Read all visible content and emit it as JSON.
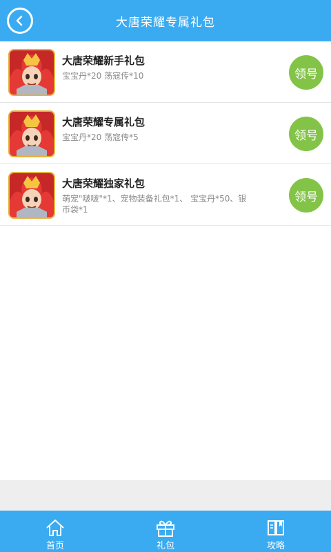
{
  "header": {
    "title": "大唐荣耀专属礼包",
    "back_icon": "chevron-left-icon"
  },
  "gifts": [
    {
      "title": "大唐荣耀新手礼包",
      "desc": "宝宝丹*20 荡寇传*10",
      "button": "领号"
    },
    {
      "title": "大唐荣耀专属礼包",
      "desc": "宝宝丹*20 荡寇传*5",
      "button": "领号"
    },
    {
      "title": "大唐荣耀独家礼包",
      "desc": "萌宠\"啵啵\"*1、宠物装备礼包*1、 宝宝丹*50、银币袋*1",
      "button": "领号"
    }
  ],
  "tabbar": {
    "items": [
      {
        "label": "首页",
        "icon": "home-icon"
      },
      {
        "label": "礼包",
        "icon": "gift-icon"
      },
      {
        "label": "攻略",
        "icon": "book-icon"
      }
    ]
  },
  "colors": {
    "primary": "#3aabf1",
    "claim_button": "#83c448"
  }
}
